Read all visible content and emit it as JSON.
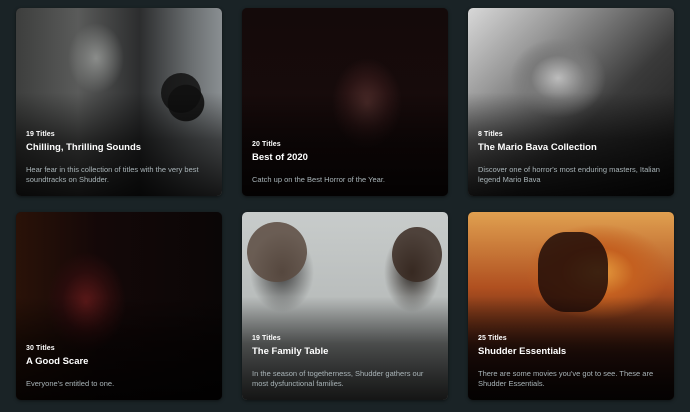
{
  "collections": [
    {
      "count": "19 Titles",
      "title": "Chilling, Thrilling Sounds",
      "description": "Hear fear in this collection of titles with the very best soundtracks on Shudder."
    },
    {
      "count": "20 Titles",
      "title": "Best of 2020",
      "description": "Catch up on the Best Horror of the Year."
    },
    {
      "count": "8 Titles",
      "title": "The Mario Bava Collection",
      "description": "Discover one of horror's most enduring masters, Italian legend Mario Bava"
    },
    {
      "count": "30 Titles",
      "title": "A Good Scare",
      "description": "Everyone's entitled to one."
    },
    {
      "count": "19 Titles",
      "title": "The Family Table",
      "description": "In the season of togetherness, Shudder gathers our most dysfunctional families."
    },
    {
      "count": "25 Titles",
      "title": "Shudder Essentials",
      "description": "There are some movies you've got to see. These are Shudder Essentials."
    }
  ],
  "colors": {
    "background": "#1a2326",
    "title_text": "#ffffff",
    "description_text": "#a9b4b8"
  }
}
